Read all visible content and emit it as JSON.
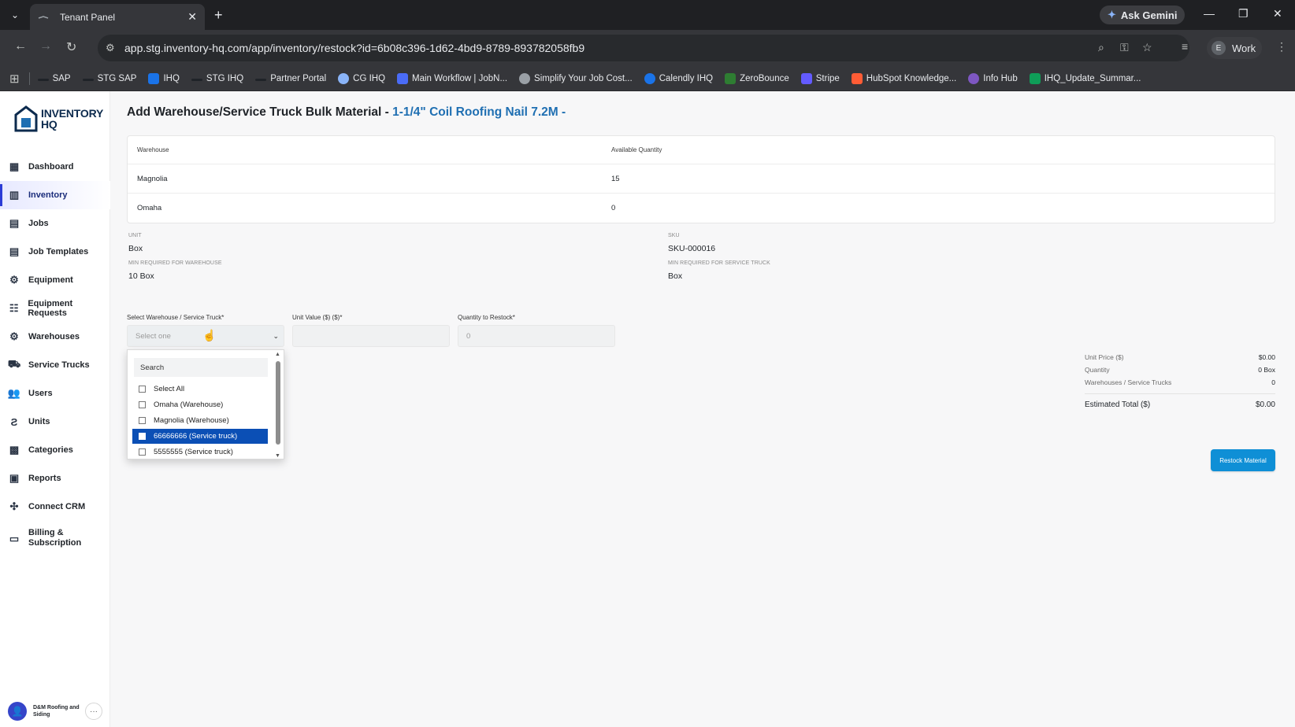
{
  "browser": {
    "tab_title": "Tenant Panel",
    "url": "app.stg.inventory-hq.com/app/inventory/restock?id=6b08c396-1d62-4bd9-8789-893782058fb9",
    "gemini_label": "Ask Gemini",
    "profile_label": "Work",
    "profile_initial": "E",
    "bookmarks": [
      "SAP",
      "STG SAP",
      "IHQ",
      "STG IHQ",
      "Partner Portal",
      "CG IHQ",
      "Main Workflow | JobN...",
      "Simplify Your Job Cost...",
      "Calendly IHQ",
      "ZeroBounce",
      "Stripe",
      "HubSpot Knowledge...",
      "Info Hub",
      "IHQ_Update_Summar..."
    ]
  },
  "sidebar": {
    "logo_line1": "INVENTORY",
    "logo_line2": "HQ",
    "items": [
      {
        "label": "Dashboard"
      },
      {
        "label": "Inventory"
      },
      {
        "label": "Jobs"
      },
      {
        "label": "Job Templates"
      },
      {
        "label": "Equipment"
      },
      {
        "label": "Equipment Requests"
      },
      {
        "label": "Warehouses"
      },
      {
        "label": "Service Trucks"
      },
      {
        "label": "Users"
      },
      {
        "label": "Units"
      },
      {
        "label": "Categories"
      },
      {
        "label": "Reports"
      },
      {
        "label": "Connect CRM"
      },
      {
        "label": "Billing &"
      },
      {
        "label": "Subscription"
      }
    ],
    "org_name": "D&M Roofing and Siding"
  },
  "page": {
    "title_prefix": "Add Warehouse/Service Truck Bulk Material -",
    "material_name": "1-1/4\" Coil Roofing Nail 7.2M -",
    "table": {
      "col_warehouse": "Warehouse",
      "col_qty": "Available Quantity",
      "rows": [
        {
          "warehouse": "Magnolia",
          "qty": "15"
        },
        {
          "warehouse": "Omaha",
          "qty": "0"
        }
      ]
    },
    "unit_label": "UNIT",
    "unit_value": "Box",
    "sku_label": "SKU",
    "sku_value": "SKU-000016",
    "min_wh_label": "MIN REQUIRED FOR WAREHOUSE",
    "min_wh_value": "10 Box",
    "min_truck_label": "MIN REQUIRED FOR SERVICE TRUCK",
    "min_truck_value": "Box",
    "form": {
      "select_label": "Select Warehouse / Service Truck*",
      "select_placeholder": "Select one",
      "unit_value_label": "Unit Value ($) ($)*",
      "unit_value_value": "",
      "qty_label": "Quantity to Restock*",
      "qty_placeholder": "0"
    },
    "dropdown": {
      "search_placeholder": "Search",
      "options": [
        "Select All",
        "Omaha (Warehouse)",
        "Magnolia (Warehouse)",
        "66666666 (Service truck)",
        "5555555 (Service truck)"
      ],
      "highlighted_index": 3
    },
    "summary": {
      "unit_price_label": "Unit Price ($)",
      "unit_price_value": "$0.00",
      "quantity_label": "Quantity",
      "quantity_value": "0 Box",
      "locations_label": "Warehouses / Service Trucks",
      "locations_value": "0",
      "total_label": "Estimated Total ($)",
      "total_value": "$0.00"
    },
    "restock_button": "Restock Material"
  }
}
